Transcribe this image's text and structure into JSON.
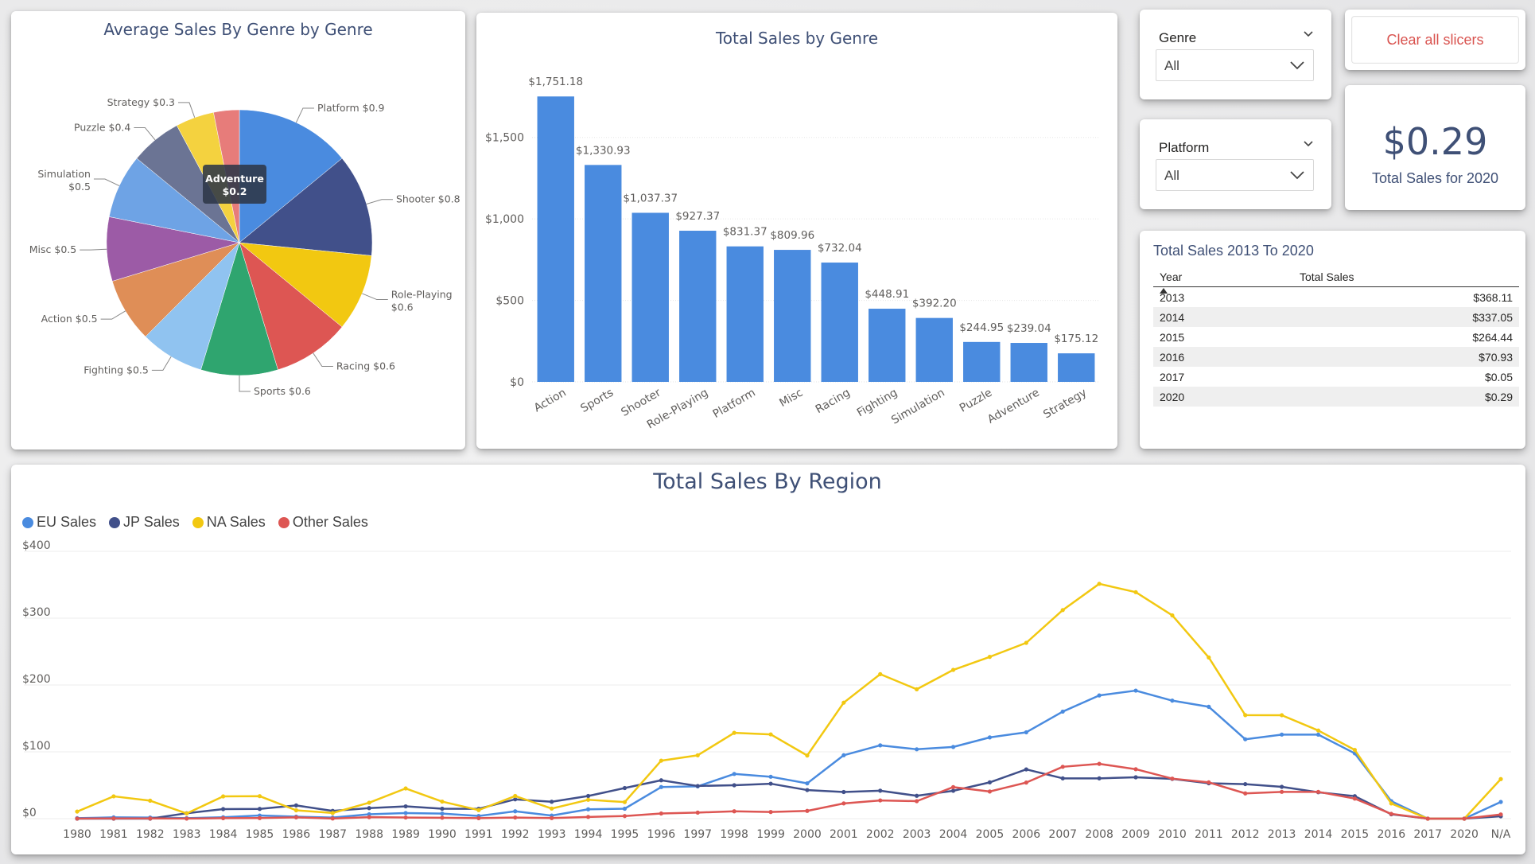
{
  "pie": {
    "title": "Average Sales By Genre by Genre",
    "tooltip_name": "Adventure",
    "tooltip_value": "$0.2"
  },
  "bar": {
    "title": "Total Sales by Genre"
  },
  "genre_slicer": {
    "label": "Genre",
    "value": "All"
  },
  "platform_slicer": {
    "label": "Platform",
    "value": "All"
  },
  "clear_button": {
    "label": "Clear all slicers"
  },
  "kpi": {
    "value": "$0.29",
    "label": "Total Sales for 2020"
  },
  "table": {
    "title": "Total Sales 2013 To 2020",
    "headers": [
      "Year",
      "Total Sales"
    ],
    "rows": [
      [
        "2013",
        "$368.11"
      ],
      [
        "2014",
        "$337.05"
      ],
      [
        "2015",
        "$264.44"
      ],
      [
        "2016",
        "$70.93"
      ],
      [
        "2017",
        "$0.05"
      ],
      [
        "2020",
        "$0.29"
      ]
    ]
  },
  "line": {
    "title": "Total Sales By Region"
  },
  "colors": {
    "blue": "#4a8bdf",
    "navy": "#41508a",
    "yellow": "#f2c811",
    "red": "#dd5653",
    "title": "#3f5076"
  },
  "chart_data": [
    {
      "type": "pie",
      "title": "Average Sales By Genre by Genre",
      "slices": [
        {
          "label": "Platform",
          "display": "Platform $0.9",
          "value": 0.9,
          "color": "#4a8bdf"
        },
        {
          "label": "Shooter",
          "display": "Shooter $0.8",
          "value": 0.8,
          "color": "#41508a"
        },
        {
          "label": "Role-Playing",
          "display": "Role-Playing $0.6",
          "value": 0.6,
          "color": "#f2c811"
        },
        {
          "label": "Racing",
          "display": "Racing $0.6",
          "value": 0.6,
          "color": "#dd5653"
        },
        {
          "label": "Sports",
          "display": "Sports $0.6",
          "value": 0.6,
          "color": "#2fa56f"
        },
        {
          "label": "Fighting",
          "display": "Fighting $0.5",
          "value": 0.5,
          "color": "#90c3f0"
        },
        {
          "label": "Action",
          "display": "Action $0.5",
          "value": 0.5,
          "color": "#df8e57"
        },
        {
          "label": "Misc",
          "display": "Misc $0.5",
          "value": 0.5,
          "color": "#9c5ba6"
        },
        {
          "label": "Simulation",
          "display": "Simulation $0.5",
          "value": 0.5,
          "color": "#6ea3e5"
        },
        {
          "label": "Puzzle",
          "display": "Puzzle $0.4",
          "value": 0.4,
          "color": "#6b7494"
        },
        {
          "label": "Strategy",
          "display": "Strategy $0.3",
          "value": 0.3,
          "color": "#f4d23f"
        },
        {
          "label": "Adventure",
          "display": "",
          "value": 0.2,
          "color": "#e77c7a"
        }
      ]
    },
    {
      "type": "bar",
      "title": "Total Sales by Genre",
      "categories": [
        "Action",
        "Sports",
        "Shooter",
        "Role-Playing",
        "Platform",
        "Misc",
        "Racing",
        "Fighting",
        "Simulation",
        "Puzzle",
        "Adventure",
        "Strategy"
      ],
      "values": [
        1751.18,
        1330.93,
        1037.37,
        927.37,
        831.37,
        809.96,
        732.04,
        448.91,
        392.2,
        244.95,
        239.04,
        175.12
      ],
      "value_labels": [
        "$1,751.18",
        "$1,330.93",
        "$1,037.37",
        "$927.37",
        "$831.37",
        "$809.96",
        "$732.04",
        "$448.91",
        "$392.20",
        "$244.95",
        "$239.04",
        "$175.12"
      ],
      "yticks": [
        0,
        500,
        1000,
        1500
      ],
      "ytick_labels": [
        "$0",
        "$500",
        "$1,000",
        "$1,500"
      ],
      "ylim": [
        0,
        1850
      ],
      "color": "#4a8bdf"
    },
    {
      "type": "line",
      "title": "Total Sales By Region",
      "x": [
        "1980",
        "1981",
        "1982",
        "1983",
        "1984",
        "1985",
        "1986",
        "1987",
        "1988",
        "1989",
        "1990",
        "1991",
        "1992",
        "1993",
        "1994",
        "1995",
        "1996",
        "1997",
        "1998",
        "1999",
        "2000",
        "2001",
        "2002",
        "2003",
        "2004",
        "2005",
        "2006",
        "2007",
        "2008",
        "2009",
        "2010",
        "2011",
        "2012",
        "2013",
        "2014",
        "2015",
        "2016",
        "2017",
        "2020",
        "N/A"
      ],
      "yticks": [
        0,
        100,
        200,
        300,
        400
      ],
      "ytick_labels": [
        "$0",
        "$100",
        "$200",
        "$300",
        "$400"
      ],
      "ylim": [
        0,
        400
      ],
      "legend_position": "top-left",
      "series": [
        {
          "name": "EU Sales",
          "color": "#4a8bdf",
          "values": [
            0.7,
            1.9,
            1.7,
            0.8,
            2.1,
            4.7,
            3,
            1.6,
            6.6,
            8.4,
            7.6,
            4,
            11,
            4.6,
            14,
            14.9,
            47.3,
            48.3,
            66.9,
            62.7,
            52.8,
            94.9,
            109.7,
            103.8,
            107.3,
            121.6,
            129.2,
            160.2,
            184.4,
            191.6,
            176.6,
            167.4,
            118.8,
            125.8,
            125.7,
            97.7,
            26.2,
            0,
            0,
            25
          ]
        },
        {
          "name": "JP Sales",
          "color": "#41508a",
          "values": [
            0,
            0,
            0,
            8.1,
            14.3,
            14.6,
            19.8,
            11.6,
            15.8,
            18.4,
            14.9,
            14.8,
            28.9,
            25.3,
            33.9,
            45.8,
            57.4,
            48.9,
            50,
            52.3,
            42.8,
            39.9,
            41.8,
            34.2,
            41.7,
            54.3,
            73.7,
            60.3,
            60.3,
            61.9,
            59.5,
            53,
            51.7,
            47.6,
            39.5,
            33.7,
            6.5,
            0.05,
            0,
            3.5
          ]
        },
        {
          "name": "NA Sales",
          "color": "#f2c811",
          "values": [
            10.6,
            33.4,
            26.9,
            7.8,
            33.3,
            33.7,
            12.5,
            8.5,
            23.9,
            45.2,
            25.5,
            12.8,
            33.9,
            15.1,
            28.2,
            24.8,
            86.8,
            94.8,
            128.4,
            126.1,
            94.5,
            173.6,
            216.2,
            193.6,
            222.6,
            242.1,
            263.1,
            312.1,
            351.4,
            338.9,
            304.2,
            241.2,
            154.9,
            154.8,
            131.9,
            102.8,
            22.7,
            0,
            0,
            59.2
          ]
        },
        {
          "name": "Other Sales",
          "color": "#dd5653",
          "values": [
            0.1,
            0.3,
            0.3,
            0.1,
            0.7,
            0.9,
            1.9,
            0.2,
            2.2,
            1.7,
            1.4,
            0.7,
            1.7,
            0.9,
            2.6,
            3.9,
            7.7,
            9.1,
            11,
            10,
            11.6,
            22.8,
            27.3,
            26.2,
            47.2,
            40.6,
            54,
            77.6,
            82,
            74,
            59.9,
            54.3,
            37.8,
            40.1,
            40.1,
            30,
            7.1,
            0,
            0,
            6.3
          ]
        }
      ]
    }
  ]
}
